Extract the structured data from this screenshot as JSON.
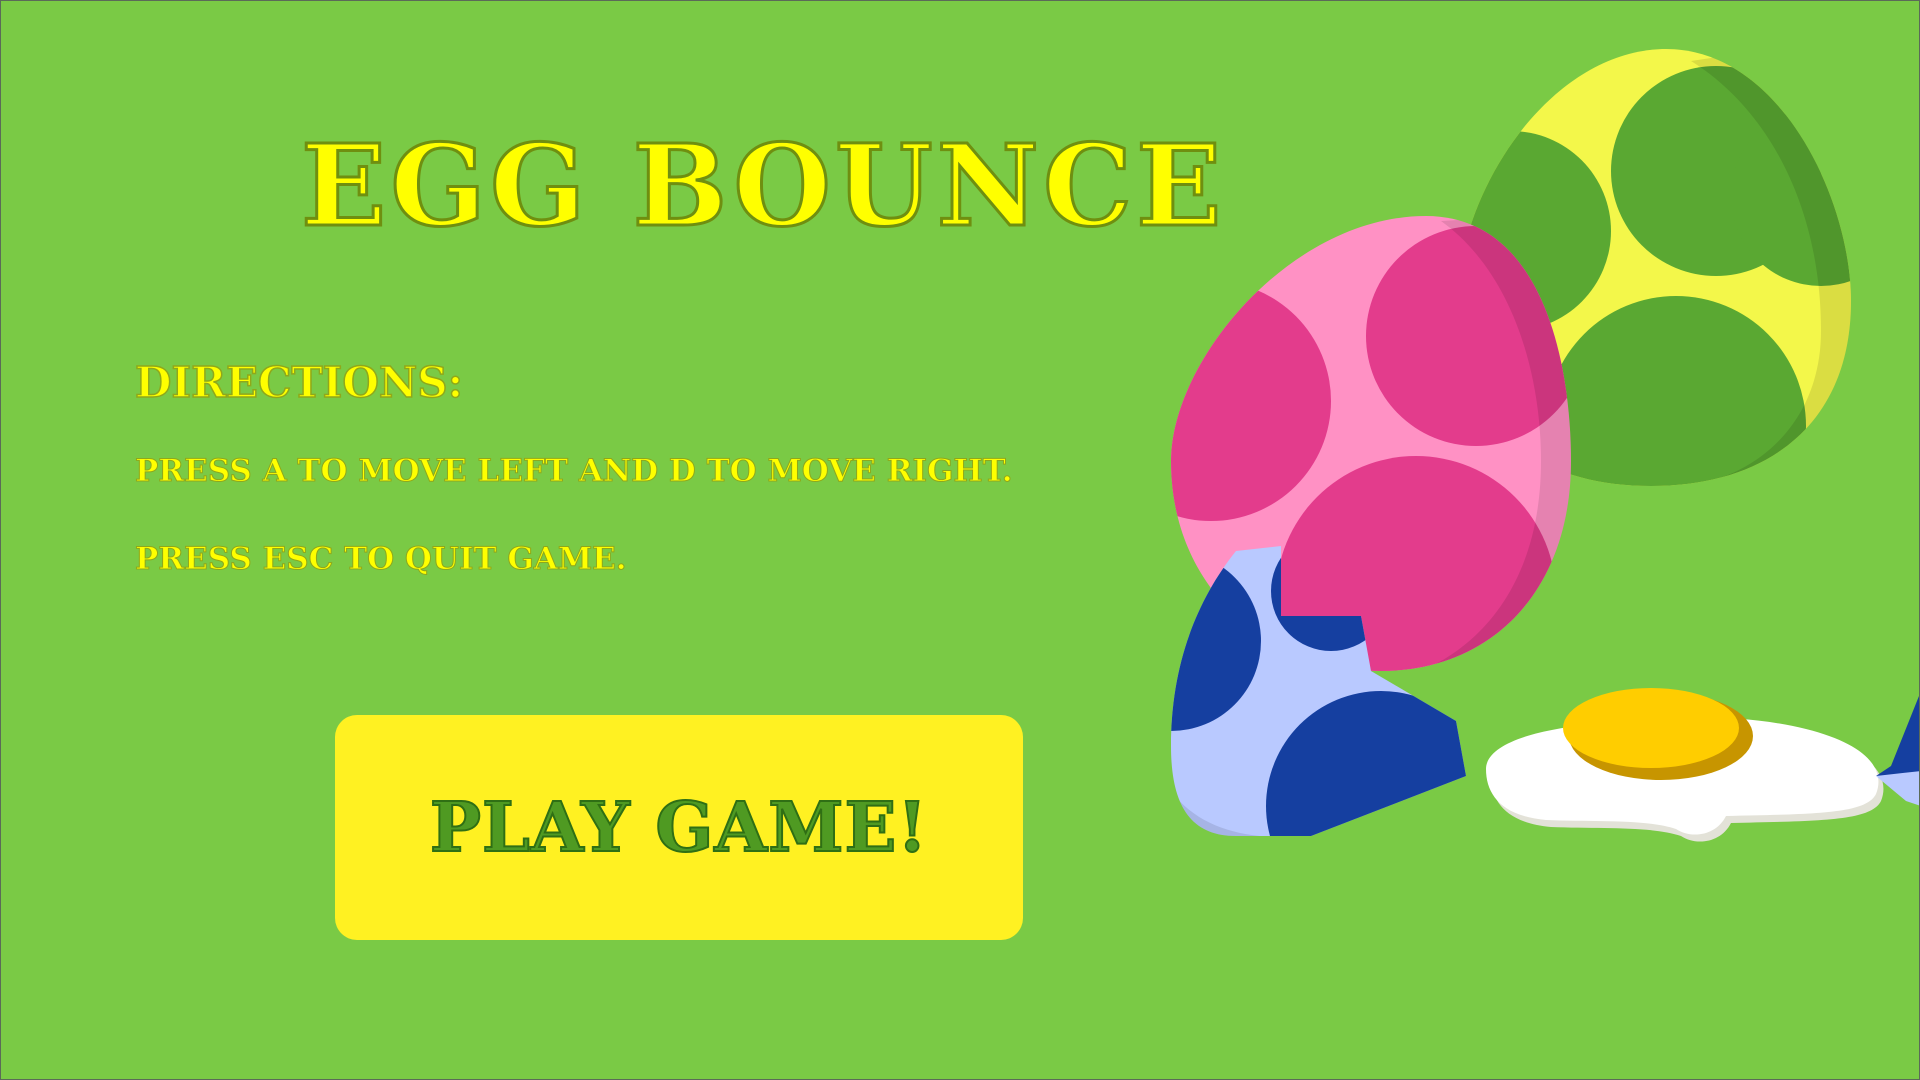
{
  "game": {
    "title": "EGG BOUNCE",
    "directions": {
      "heading": "DIRECTIONS:",
      "lines": [
        "PRESS A TO MOVE LEFT AND D TO MOVE RIGHT.",
        "PRESS ESC TO QUIT GAME."
      ]
    },
    "play_button_label": "PLAY GAME!"
  },
  "colors": {
    "background": "#7aca45",
    "title_text": "#ffff00",
    "button_fill": "#fff122",
    "button_text": "#4f9a22",
    "pink_egg": "#ff91c4",
    "pink_spots": "#e33c8c",
    "yellow_egg": "#f3f74a",
    "green_spots": "#5aa832",
    "blue_shell": "#b9c9ff",
    "blue_spots": "#153fa0",
    "egg_white": "#ffffff",
    "yolk": "#ffcd00"
  },
  "art": {
    "icons": [
      "yellow-spotted-egg-icon",
      "pink-spotted-egg-icon",
      "cracked-blue-egg-icon",
      "fried-egg-icon"
    ]
  }
}
